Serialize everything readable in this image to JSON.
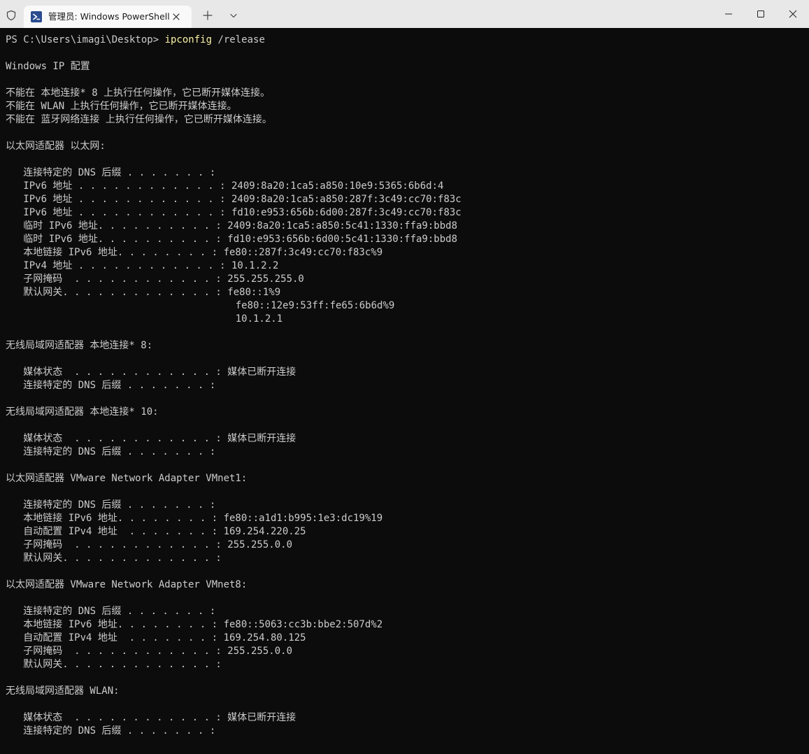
{
  "tab": {
    "title": "管理员: Windows PowerShell",
    "icon": "powershell-icon"
  },
  "titlebar": {
    "shield_icon": "shield-icon",
    "new_tab_icon": "plus-icon",
    "dropdown_icon": "chevron-down-icon",
    "minimize_icon": "minimize-icon",
    "maximize_icon": "maximize-icon",
    "close_icon": "close-icon"
  },
  "colors": {
    "terminal_bg": "#0c0c0c",
    "terminal_fg": "#cccccc",
    "command_fg": "#f9f1a5",
    "titlebar_bg": "#e8e8e8",
    "tab_bg": "#f9f9f9"
  },
  "terminal": {
    "prompt": "PS C:\\Users\\imagi\\Desktop> ",
    "command": "ipconfig",
    "argument": " /release",
    "output": [
      "",
      "Windows IP 配置",
      "",
      "不能在 本地连接* 8 上执行任何操作，它已断开媒体连接。",
      "不能在 WLAN 上执行任何操作，它已断开媒体连接。",
      "不能在 蓝牙网络连接 上执行任何操作，它已断开媒体连接。",
      "",
      "以太网适配器 以太网:",
      "",
      "   连接特定的 DNS 后缀 . . . . . . . :",
      "   IPv6 地址 . . . . . . . . . . . . : 2409:8a20:1ca5:a850:10e9:5365:6b6d:4",
      "   IPv6 地址 . . . . . . . . . . . . : 2409:8a20:1ca5:a850:287f:3c49:cc70:f83c",
      "   IPv6 地址 . . . . . . . . . . . . : fd10:e953:656b:6d00:287f:3c49:cc70:f83c",
      "   临时 IPv6 地址. . . . . . . . . . : 2409:8a20:1ca5:a850:5c41:1330:ffa9:bbd8",
      "   临时 IPv6 地址. . . . . . . . . . : fd10:e953:656b:6d00:5c41:1330:ffa9:bbd8",
      "   本地链接 IPv6 地址. . . . . . . . : fe80::287f:3c49:cc70:f83c%9",
      "   IPv4 地址 . . . . . . . . . . . . : 10.1.2.2",
      "   子网掩码  . . . . . . . . . . . . : 255.255.255.0",
      "   默认网关. . . . . . . . . . . . . : fe80::1%9",
      "                                       fe80::12e9:53ff:fe65:6b6d%9",
      "                                       10.1.2.1",
      "",
      "无线局域网适配器 本地连接* 8:",
      "",
      "   媒体状态  . . . . . . . . . . . . : 媒体已断开连接",
      "   连接特定的 DNS 后缀 . . . . . . . :",
      "",
      "无线局域网适配器 本地连接* 10:",
      "",
      "   媒体状态  . . . . . . . . . . . . : 媒体已断开连接",
      "   连接特定的 DNS 后缀 . . . . . . . :",
      "",
      "以太网适配器 VMware Network Adapter VMnet1:",
      "",
      "   连接特定的 DNS 后缀 . . . . . . . :",
      "   本地链接 IPv6 地址. . . . . . . . : fe80::a1d1:b995:1e3:dc19%19",
      "   自动配置 IPv4 地址  . . . . . . . : 169.254.220.25",
      "   子网掩码  . . . . . . . . . . . . : 255.255.0.0",
      "   默认网关. . . . . . . . . . . . . :",
      "",
      "以太网适配器 VMware Network Adapter VMnet8:",
      "",
      "   连接特定的 DNS 后缀 . . . . . . . :",
      "   本地链接 IPv6 地址. . . . . . . . : fe80::5063:cc3b:bbe2:507d%2",
      "   自动配置 IPv4 地址  . . . . . . . : 169.254.80.125",
      "   子网掩码  . . . . . . . . . . . . : 255.255.0.0",
      "   默认网关. . . . . . . . . . . . . :",
      "",
      "无线局域网适配器 WLAN:",
      "",
      "   媒体状态  . . . . . . . . . . . . : 媒体已断开连接",
      "   连接特定的 DNS 后缀 . . . . . . . :"
    ]
  }
}
